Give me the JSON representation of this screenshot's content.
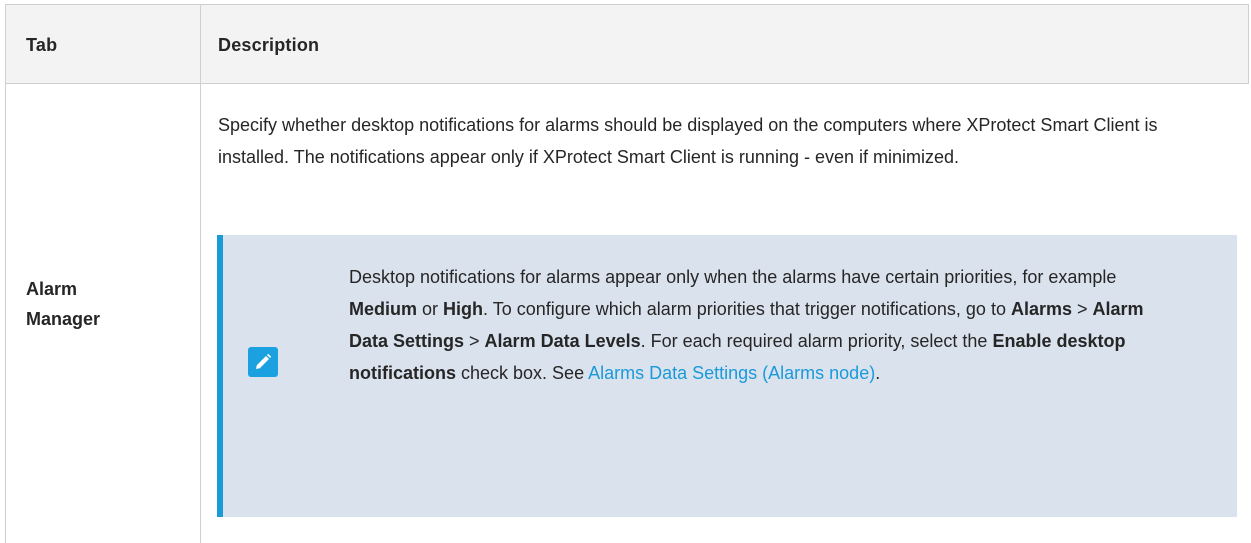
{
  "table": {
    "header": {
      "tab": "Tab",
      "description": "Description"
    },
    "row": {
      "tab_line1": "Alarm",
      "tab_line2": "Manager",
      "description": "Specify whether desktop notifications for alarms should be displayed on the computers where XProtect Smart Client is installed. The notifications appear only if XProtect Smart Client is running - even if minimized."
    }
  },
  "note": {
    "icon": "pencil-icon",
    "accent_color": "#1a9ad9",
    "background_color": "#dae2ee",
    "t1": "Desktop notifications for alarms appear only when the alarms have certain priorities, for example ",
    "b1": "Medium",
    "t2": " or ",
    "b2": "High",
    "t3": ". To configure which alarm priorities that trigger notifications, go to ",
    "b3": "Alarms",
    "t4": " > ",
    "b4": "Alarm Data Settings",
    "t5": " > ",
    "b5": "Alarm Data Levels",
    "t6": ". For each required alarm priority, select the ",
    "b6": "Enable desktop notifications",
    "t7": " check box. See ",
    "link": "Alarms Data Settings (Alarms node)",
    "t8": "."
  }
}
